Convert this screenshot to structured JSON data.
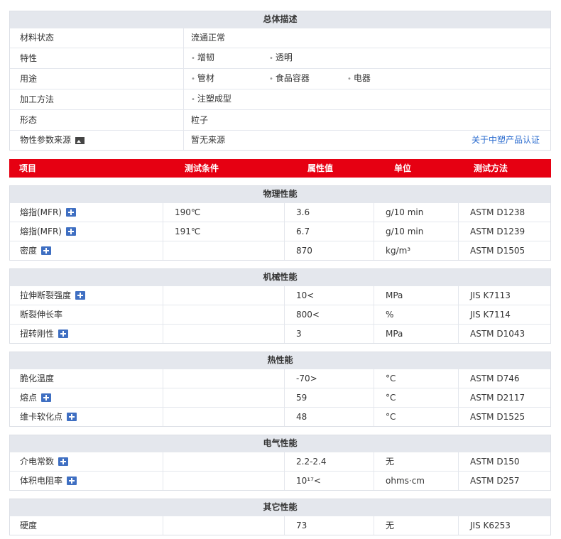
{
  "overview": {
    "title": "总体描述",
    "material_status": {
      "label": "材料状态",
      "value": "流通正常"
    },
    "features": {
      "label": "特性",
      "tags": [
        "增韧",
        "透明"
      ]
    },
    "uses": {
      "label": "用途",
      "tags": [
        "管材",
        "食品容器",
        "电器"
      ]
    },
    "processing": {
      "label": "加工方法",
      "tags": [
        "注塑成型"
      ]
    },
    "form": {
      "label": "形态",
      "value": "粒子"
    },
    "source": {
      "label": "物性参数来源",
      "value": "暂无来源",
      "link": "关于中塑产品认证"
    }
  },
  "columns": [
    "项目",
    "测试条件",
    "属性值",
    "单位",
    "测试方法"
  ],
  "accent_color": "#e60012",
  "sections": [
    {
      "title": "物理性能",
      "rows": [
        {
          "item": "熔指(MFR)",
          "plus": true,
          "condition": "190℃",
          "value": "3.6",
          "unit": "g/10 min",
          "method": "ASTM D1238"
        },
        {
          "item": "熔指(MFR)",
          "plus": true,
          "condition": "191℃",
          "value": "6.7",
          "unit": "g/10 min",
          "method": "ASTM D1239"
        },
        {
          "item": "密度",
          "plus": true,
          "condition": "",
          "value": "870",
          "unit": "kg/m³",
          "method": "ASTM D1505"
        }
      ]
    },
    {
      "title": "机械性能",
      "rows": [
        {
          "item": "拉伸断裂强度",
          "plus": true,
          "condition": "",
          "value": "10<",
          "unit": "MPa",
          "method": "JIS K7113"
        },
        {
          "item": "断裂伸长率",
          "plus": false,
          "condition": "",
          "value": "800<",
          "unit": "%",
          "method": "JIS K7114"
        },
        {
          "item": "扭转刚性",
          "plus": true,
          "condition": "",
          "value": "3",
          "unit": "MPa",
          "method": "ASTM D1043"
        }
      ]
    },
    {
      "title": "热性能",
      "rows": [
        {
          "item": "脆化温度",
          "plus": false,
          "condition": "",
          "value": "-70>",
          "unit": "°C",
          "method": "ASTM D746"
        },
        {
          "item": "熔点",
          "plus": true,
          "condition": "",
          "value": "59",
          "unit": "°C",
          "method": "ASTM D2117"
        },
        {
          "item": "维卡软化点",
          "plus": true,
          "condition": "",
          "value": "48",
          "unit": "°C",
          "method": "ASTM D1525"
        }
      ]
    },
    {
      "title": "电气性能",
      "rows": [
        {
          "item": "介电常数",
          "plus": true,
          "condition": "",
          "value": "2.2-2.4",
          "unit": "无",
          "method": "ASTM D150"
        },
        {
          "item": "体积电阻率",
          "plus": true,
          "condition": "",
          "value": "10¹⁷<",
          "unit": "ohms·cm",
          "method": "ASTM D257"
        }
      ]
    },
    {
      "title": "其它性能",
      "rows": [
        {
          "item": "硬度",
          "plus": false,
          "condition": "",
          "value": "73",
          "unit": "无",
          "method": "JIS K6253"
        }
      ]
    }
  ]
}
